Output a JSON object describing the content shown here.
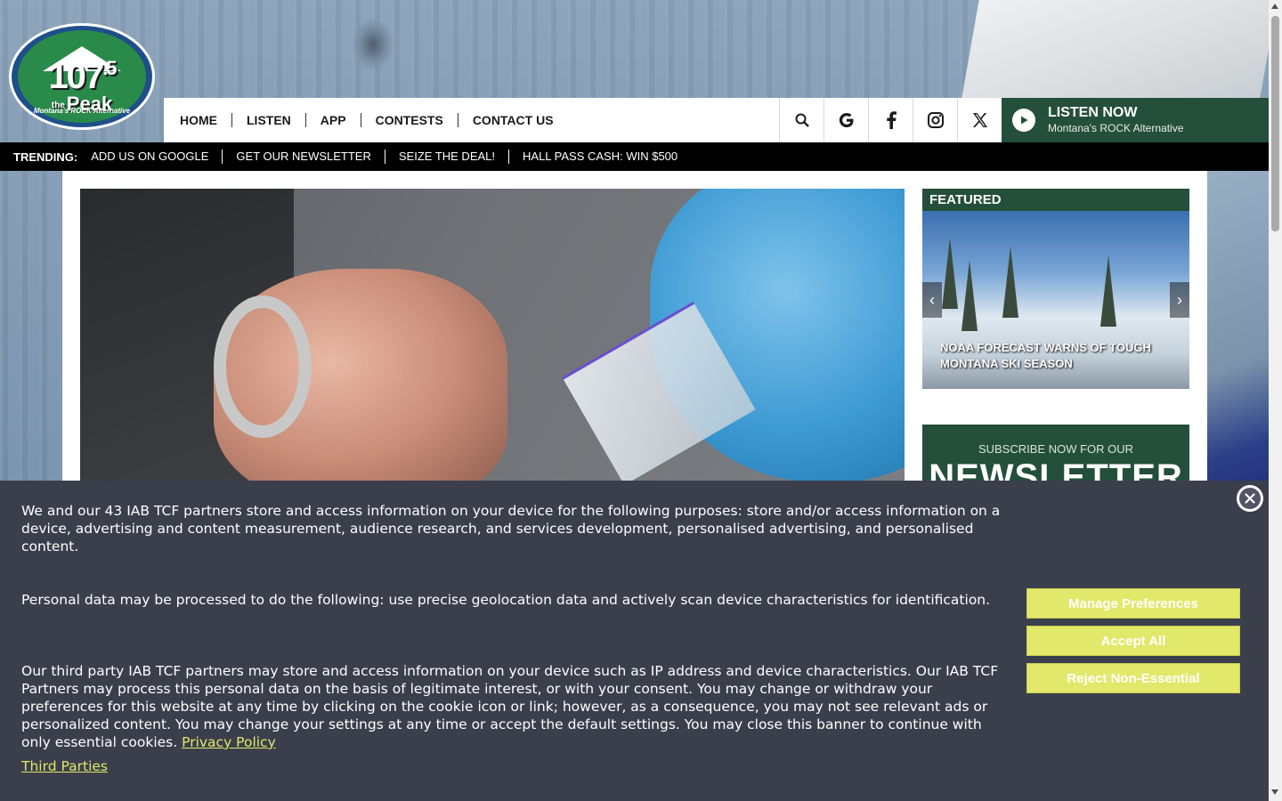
{
  "brand": {
    "logo_number": "107",
    "logo_decimal": ".5",
    "logo_the": "the",
    "logo_name": "Peak",
    "logo_tagline": "Montana's ROCK Alternative",
    "primary_color": "#244f3a",
    "accent_color": "#e1e86a"
  },
  "nav": {
    "items": [
      {
        "label": "HOME"
      },
      {
        "label": "LISTEN"
      },
      {
        "label": "APP"
      },
      {
        "label": "CONTESTS"
      },
      {
        "label": "CONTACT US"
      }
    ],
    "icons": [
      "search-icon",
      "google-icon",
      "facebook-icon",
      "instagram-icon",
      "x-twitter-icon"
    ]
  },
  "listen_now": {
    "title": "LISTEN NOW",
    "subtitle": "Montana's ROCK Alternative"
  },
  "trending": {
    "label": "TRENDING:",
    "items": [
      {
        "label": "ADD US ON GOOGLE"
      },
      {
        "label": "GET OUR NEWSLETTER"
      },
      {
        "label": "SEIZE THE DEAL!"
      },
      {
        "label": "HALL PASS CASH: WIN $500"
      }
    ]
  },
  "featured": {
    "header": "FEATURED",
    "caption": "NOAA FORECAST WARNS OF TOUGH MONTANA SKI SEASON"
  },
  "newsletter": {
    "subtitle": "SUBSCRIBE NOW FOR OUR",
    "title": "NEWSLETTER"
  },
  "consent": {
    "paragraph1": "We and our 43 IAB TCF partners store and access information on your device for the following purposes: store and/or access information on a device, advertising and content measurement, audience research, and services development, personalised advertising, and personalised content.",
    "paragraph2": "Personal data may be processed to do the following: use precise geolocation data and actively scan device characteristics for identification.",
    "paragraph3": "Our third party IAB TCF partners may store and access information on your device such as IP address and device characteristics. Our IAB TCF Partners may process this personal data on the basis of legitimate interest, or with your consent. You may change or withdraw your preferences for this website at any time by clicking on the cookie icon or link; however, as a consequence, you may not see relevant ads or personalized content. You may change your settings at any time or accept the default settings. You may close this banner to continue with only essential cookies.",
    "privacy_link": "Privacy Policy",
    "third_parties_link": "Third Parties",
    "buttons": {
      "manage": "Manage Preferences",
      "accept": "Accept All",
      "reject": "Reject Non-Essential"
    }
  }
}
